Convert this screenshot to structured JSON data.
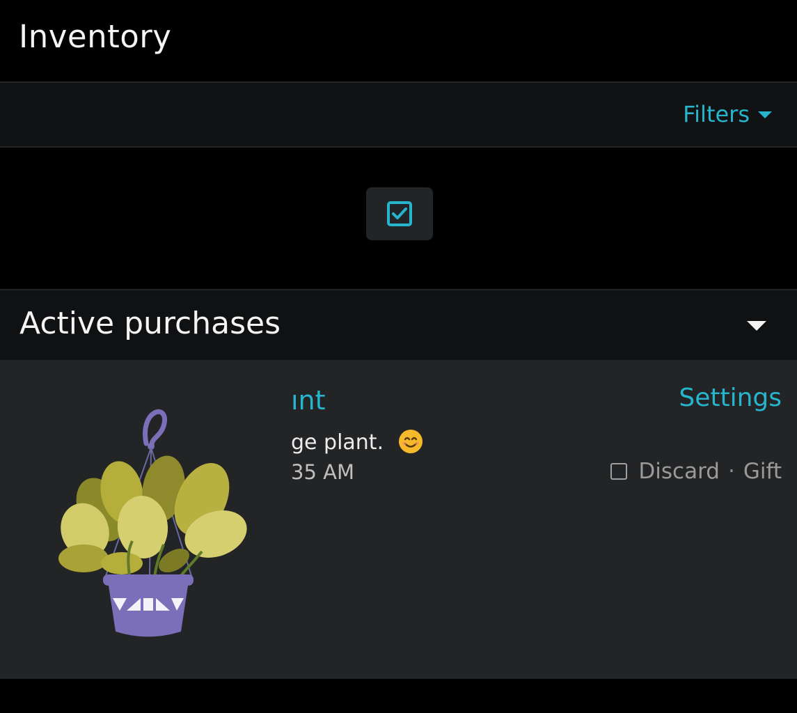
{
  "header": {
    "title": "Inventory"
  },
  "filters": {
    "label": "Filters",
    "icon": "caret-down-icon"
  },
  "select_toggle": {
    "icon": "checkbox-checked-icon"
  },
  "section": {
    "title": "Active purchases",
    "icon": "caret-down-icon"
  },
  "item": {
    "title": "ınt",
    "description": "ge plant.",
    "time": "35 AM",
    "settings_label": "Settings",
    "discard_label": "Discard",
    "separator": "·",
    "gift_label": "Gift",
    "image": "hanging-plant-illustration"
  },
  "colors": {
    "accent": "#26b5cc",
    "background": "#000000",
    "card": "#222426",
    "bar": "#111213",
    "pot": "#7a6fb8",
    "leaf": "#c9c25a"
  }
}
